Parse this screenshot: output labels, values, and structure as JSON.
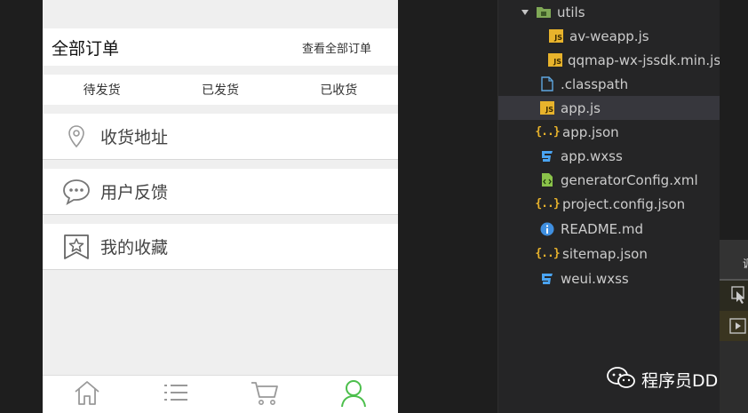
{
  "phone": {
    "orders_title": "全部订单",
    "orders_link": "查看全部订单",
    "status_tabs": [
      "待发货",
      "已发货",
      "已收货"
    ],
    "menu": [
      {
        "label": "收货地址",
        "icon": "location-pin-icon"
      },
      {
        "label": "用户反馈",
        "icon": "chat-bubble-icon"
      },
      {
        "label": "我的收藏",
        "icon": "star-bookmark-icon"
      }
    ],
    "tabbar": [
      {
        "icon": "home-icon",
        "active": false
      },
      {
        "icon": "list-icon",
        "active": false
      },
      {
        "icon": "cart-icon",
        "active": false
      },
      {
        "icon": "user-icon",
        "active": true
      }
    ],
    "active_color": "#4cbf4c"
  },
  "explorer": {
    "files": [
      {
        "name": "utils",
        "type": "folder",
        "expanded": true
      },
      {
        "name": "av-weapp.js",
        "type": "js"
      },
      {
        "name": "qqmap-wx-jssdk.min.js",
        "type": "js"
      },
      {
        "name": ".classpath",
        "type": "file"
      },
      {
        "name": "app.js",
        "type": "js",
        "selected": true
      },
      {
        "name": "app.json",
        "type": "json"
      },
      {
        "name": "app.wxss",
        "type": "css"
      },
      {
        "name": "generatorConfig.xml",
        "type": "xml"
      },
      {
        "name": "project.config.json",
        "type": "json"
      },
      {
        "name": "README.md",
        "type": "info"
      },
      {
        "name": "sitemap.json",
        "type": "json"
      },
      {
        "name": "weui.wxss",
        "type": "css"
      }
    ],
    "js_badge": "JS",
    "json_glyph": "{..}"
  },
  "watermark": "程序员DD",
  "right_panel_label": "调"
}
